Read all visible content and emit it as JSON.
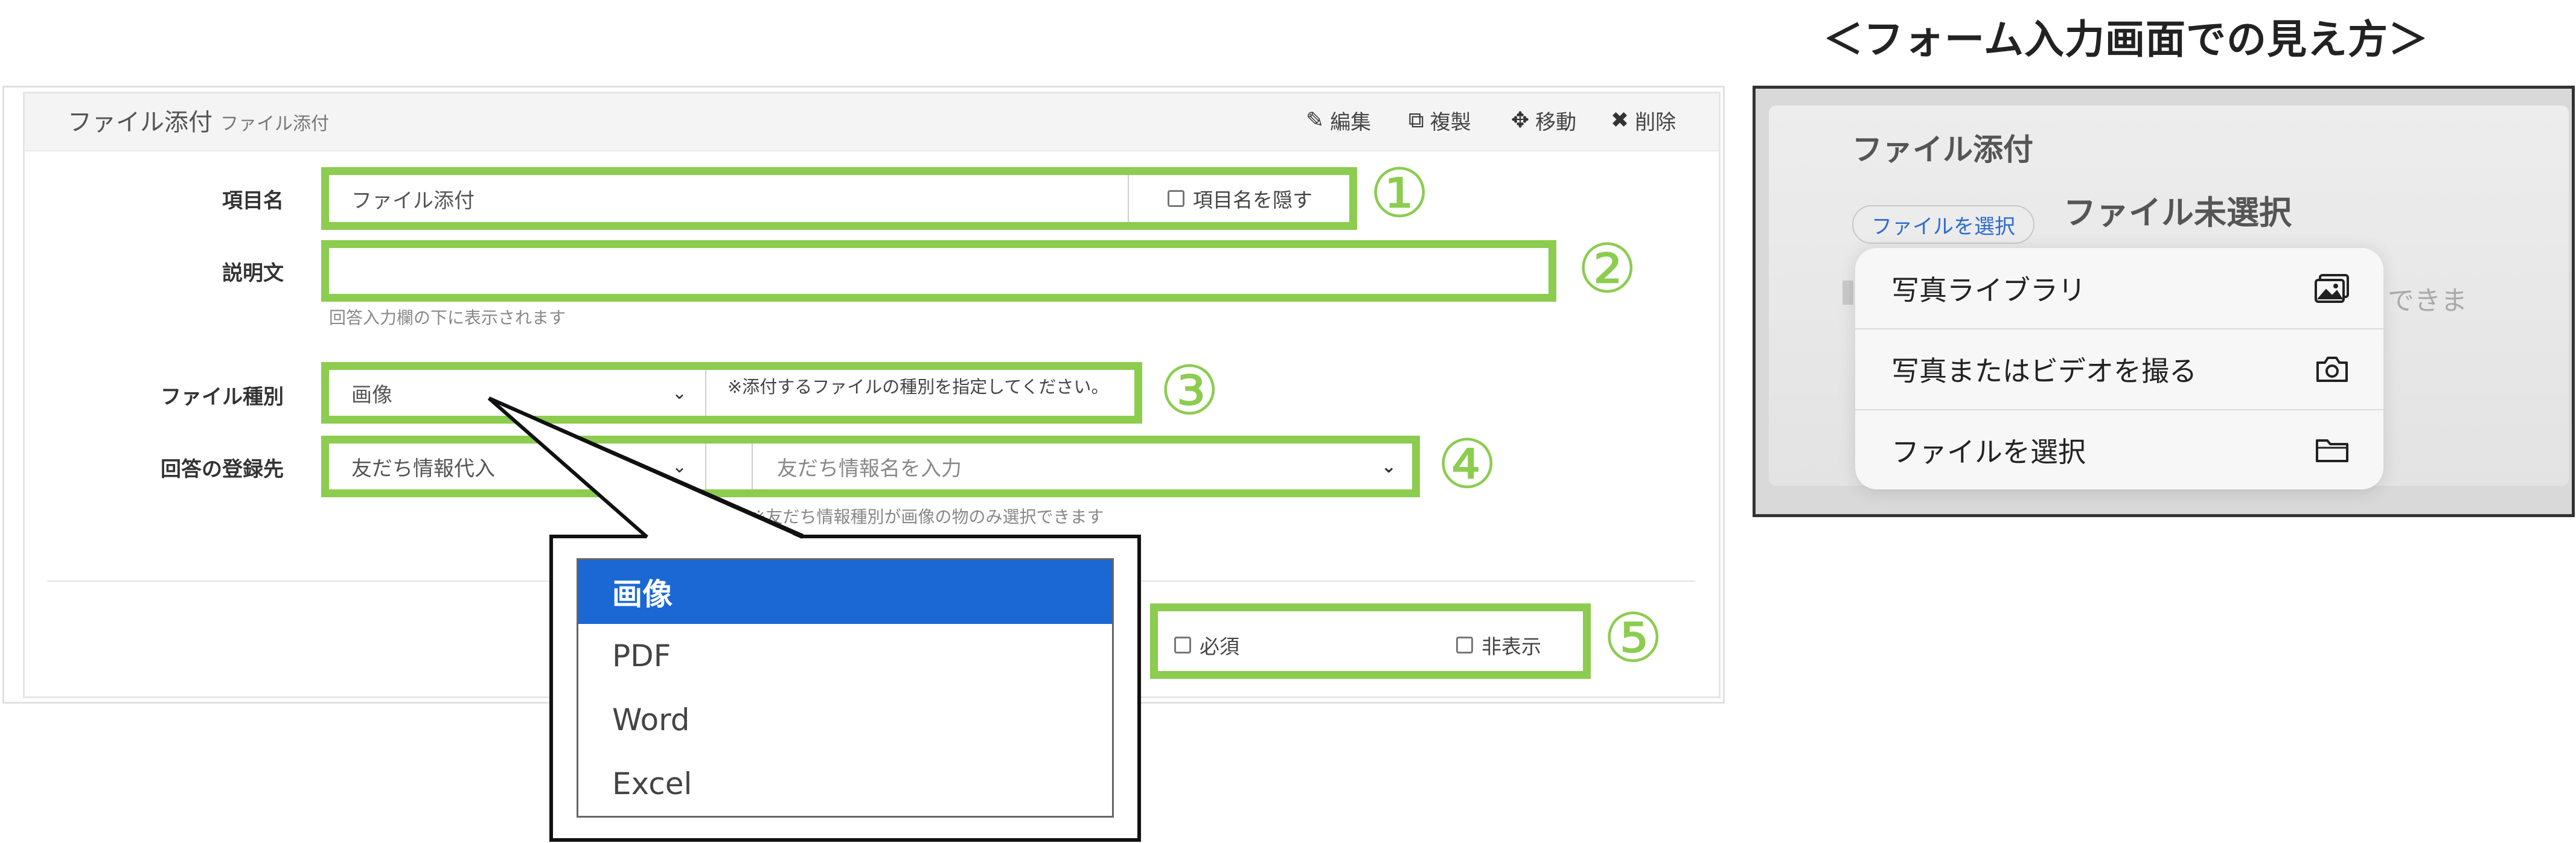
{
  "editor": {
    "title": "ファイル添付",
    "subtitle": "ファイル添付",
    "tools": [
      {
        "icon": "pencil-icon",
        "label": "編集"
      },
      {
        "icon": "copy-icon",
        "label": "複製"
      },
      {
        "icon": "move-icon",
        "label": "移動"
      },
      {
        "icon": "close-icon",
        "label": "削除"
      }
    ],
    "item_name": {
      "label": "項目名",
      "value": "ファイル添付",
      "hide_label": "項目名を隠す"
    },
    "description": {
      "label": "説明文",
      "value": "",
      "hint": "回答入力欄の下に表示されます"
    },
    "file_type": {
      "label": "ファイル種別",
      "value": "画像",
      "note": "※添付するファイルの種別を指定してください。"
    },
    "register_to": {
      "label": "回答の登録先",
      "value": "友だち情報代入",
      "placeholder": "友だち情報名を入力",
      "hint": "※友だち情報種別が画像の物のみ選択できます"
    },
    "required_label": "必須",
    "hidden_label": "非表示",
    "markers": [
      "①",
      "②",
      "③",
      "④",
      "⑤"
    ]
  },
  "dropdown": {
    "options": [
      "画像",
      "PDF",
      "Word",
      "Excel"
    ],
    "selected": "画像"
  },
  "preview": {
    "heading": "＜フォーム入力画面での見え方＞",
    "field_title": "ファイル添付",
    "choose_button": "ファイルを選択",
    "no_file": "ファイル未選択",
    "bg_text": "できま",
    "menu": [
      {
        "label": "写真ライブラリ",
        "icon": "photo-library-icon"
      },
      {
        "label": "写真またはビデオを撮る",
        "icon": "camera-icon"
      },
      {
        "label": "ファイルを選択",
        "icon": "folder-icon"
      }
    ]
  },
  "colors": {
    "accent_green": "#8ccc4f",
    "selected_blue": "#1b67d4"
  }
}
